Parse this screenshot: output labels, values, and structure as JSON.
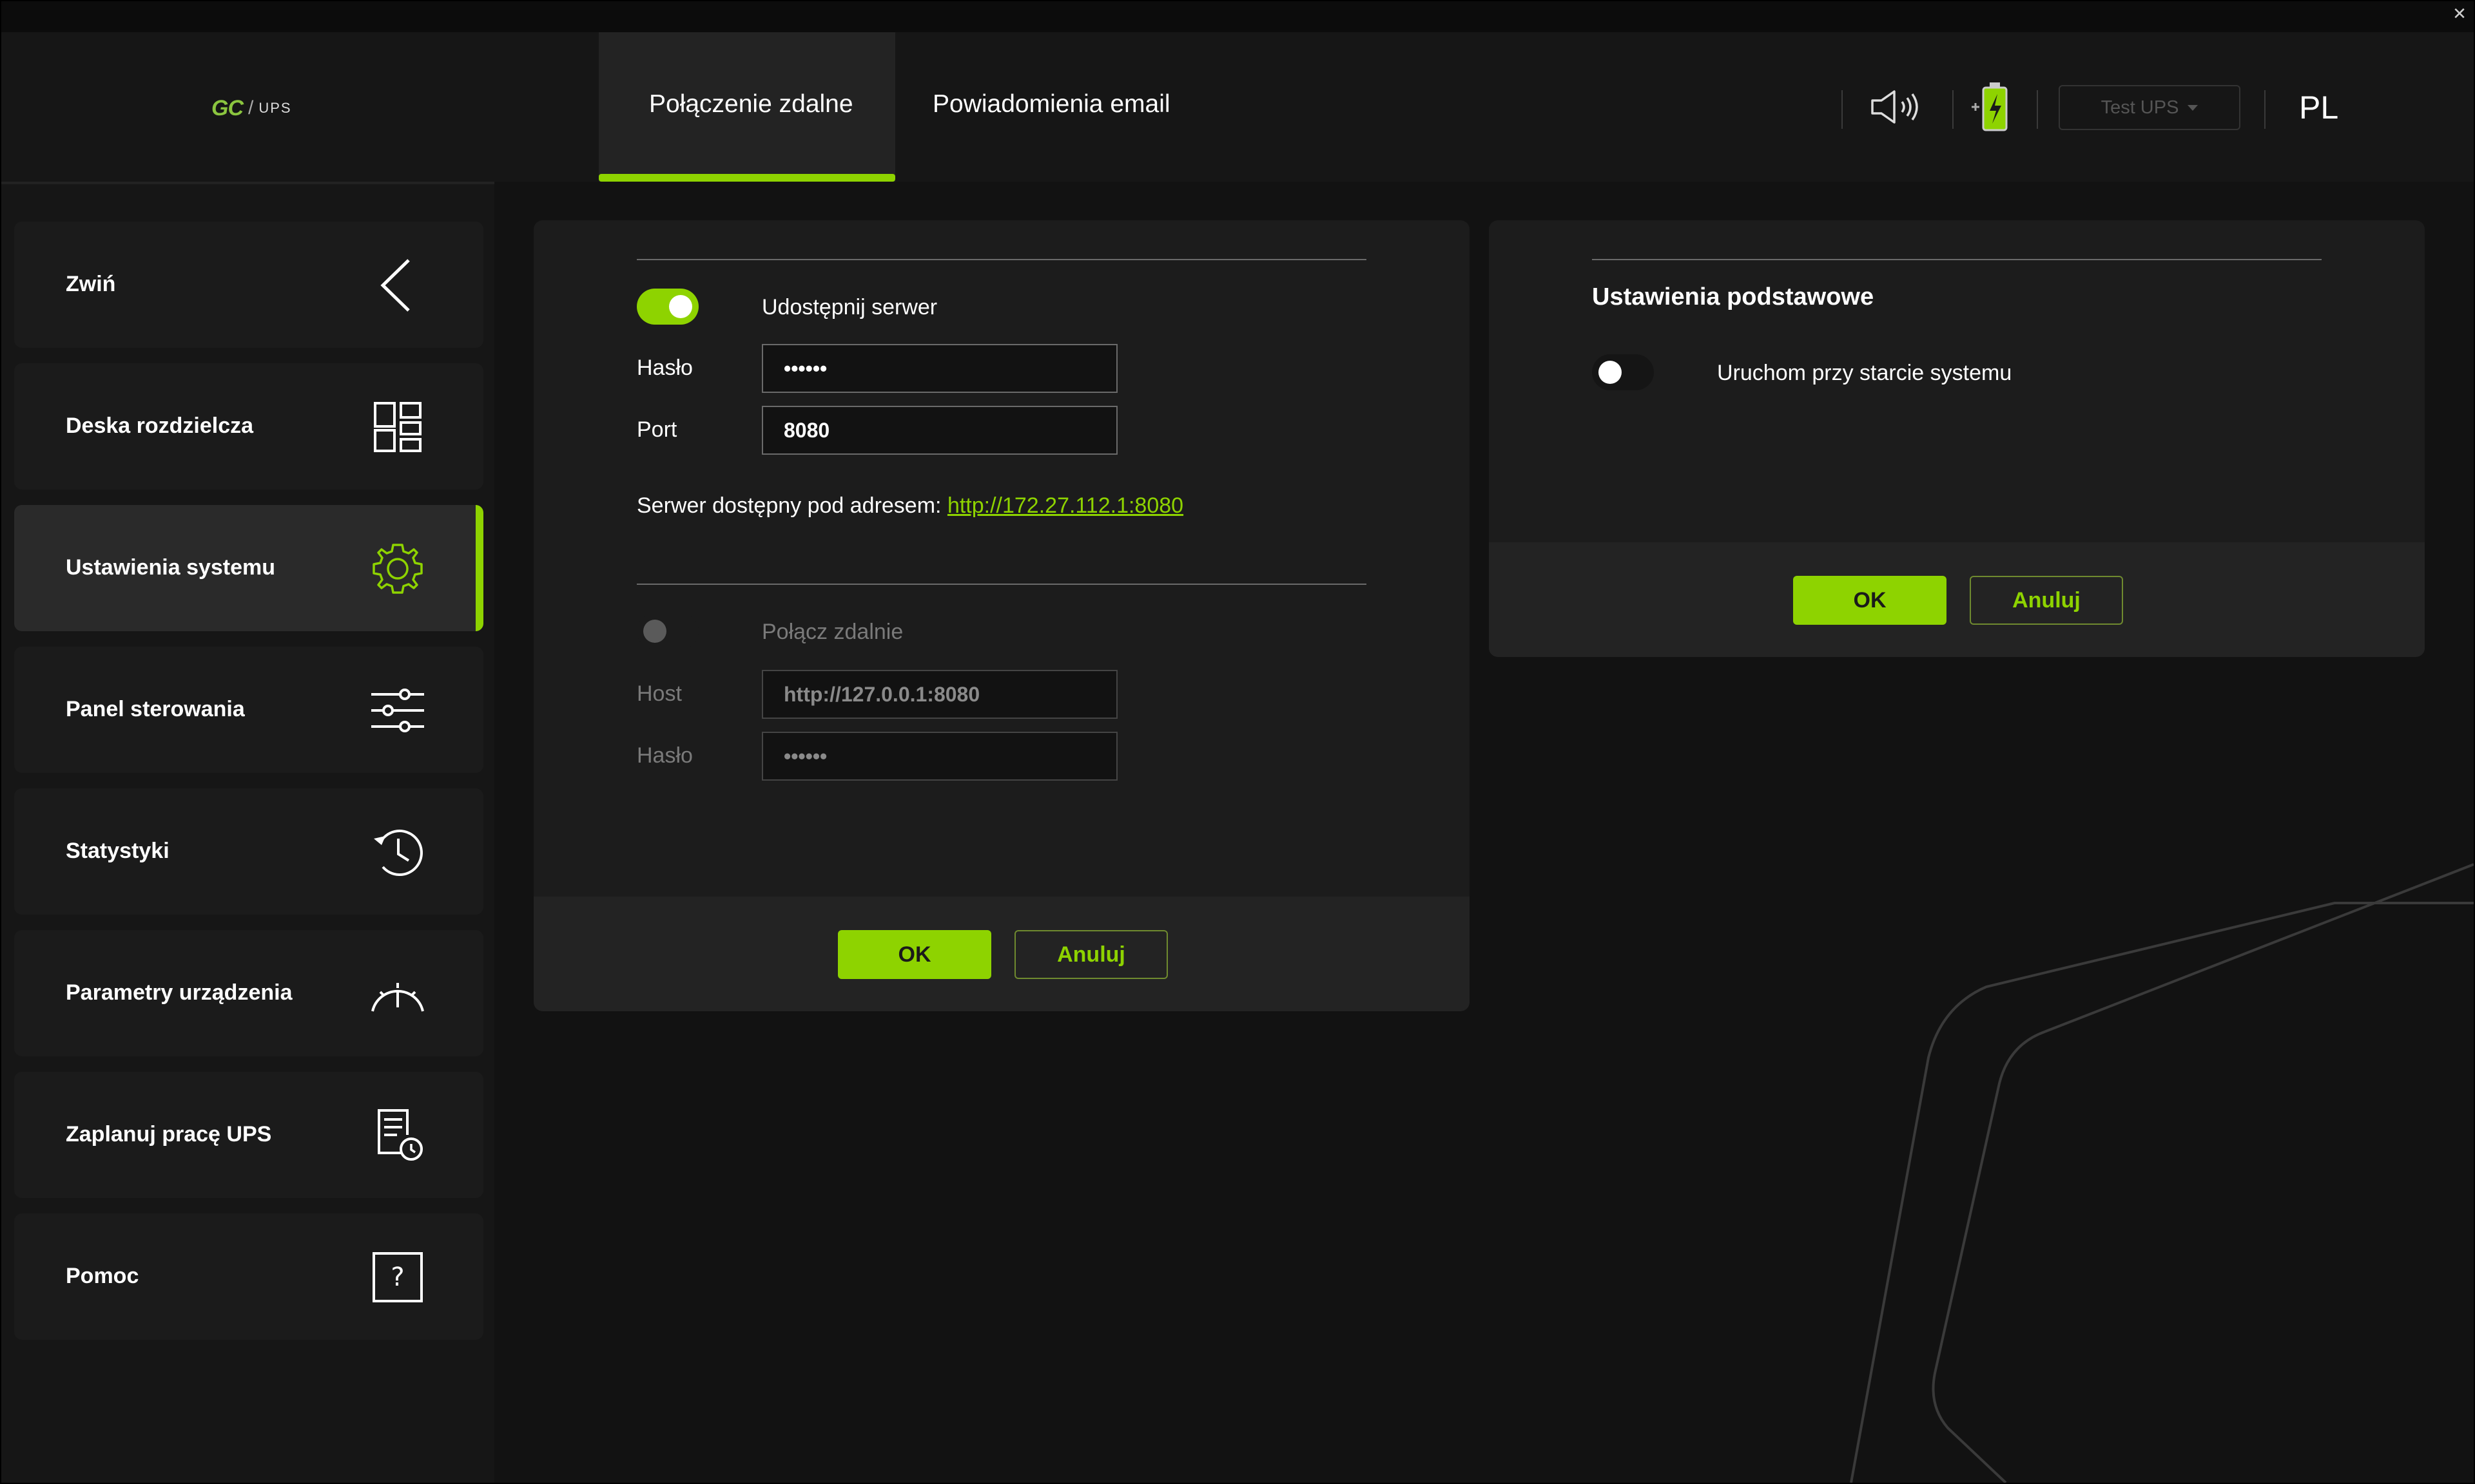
{
  "window": {
    "close_glyph": "✕"
  },
  "logo": {
    "brand": "GC",
    "separator": "/",
    "product": "UPS"
  },
  "sidebar": {
    "items": [
      {
        "label": "Zwiń",
        "icon": "chevron-left-icon",
        "active": false
      },
      {
        "label": "Deska rozdzielcza",
        "icon": "dashboard-grid-icon",
        "active": false
      },
      {
        "label": "Ustawienia systemu",
        "icon": "gear-icon",
        "active": true
      },
      {
        "label": "Panel sterowania",
        "icon": "sliders-icon",
        "active": false
      },
      {
        "label": "Statystyki",
        "icon": "history-clock-icon",
        "active": false
      },
      {
        "label": "Parametry urządzenia",
        "icon": "gauge-icon",
        "active": false
      },
      {
        "label": "Zaplanuj pracę UPS",
        "icon": "schedule-document-icon",
        "active": false
      },
      {
        "label": "Pomoc",
        "icon": "help-question-icon",
        "active": false
      }
    ]
  },
  "header": {
    "tabs": [
      {
        "label": "Połączenie zdalne",
        "active": true
      },
      {
        "label": "Powiadomienia email",
        "active": false
      }
    ],
    "sound_icon": "speaker-volume-icon",
    "battery_icon": "battery-charging-icon",
    "ups_select": {
      "value": "Test UPS"
    },
    "language": "PL"
  },
  "remote_panel": {
    "server": {
      "toggle_label": "Udostępnij serwer",
      "enabled": true,
      "password_label": "Hasło",
      "password_value": "••••••",
      "port_label": "Port",
      "port_value": "8080",
      "address_prefix": "Serwer dostępny pod adresem:",
      "address_link": "http://172.27.112.1:8080"
    },
    "client": {
      "toggle_label": "Połącz zdalnie",
      "enabled": false,
      "host_label": "Host",
      "host_value": "http://127.0.0.1:8080",
      "password_label": "Hasło",
      "password_value": "••••••"
    },
    "ok_label": "OK",
    "cancel_label": "Anuluj"
  },
  "basic_panel": {
    "title": "Ustawienia podstawowe",
    "autostart_label": "Uruchom przy starcie systemu",
    "autostart_enabled": false,
    "ok_label": "OK",
    "cancel_label": "Anuluj"
  },
  "colors": {
    "accent": "#8ed300",
    "background": "#121212",
    "panel": "#1c1c1c"
  }
}
